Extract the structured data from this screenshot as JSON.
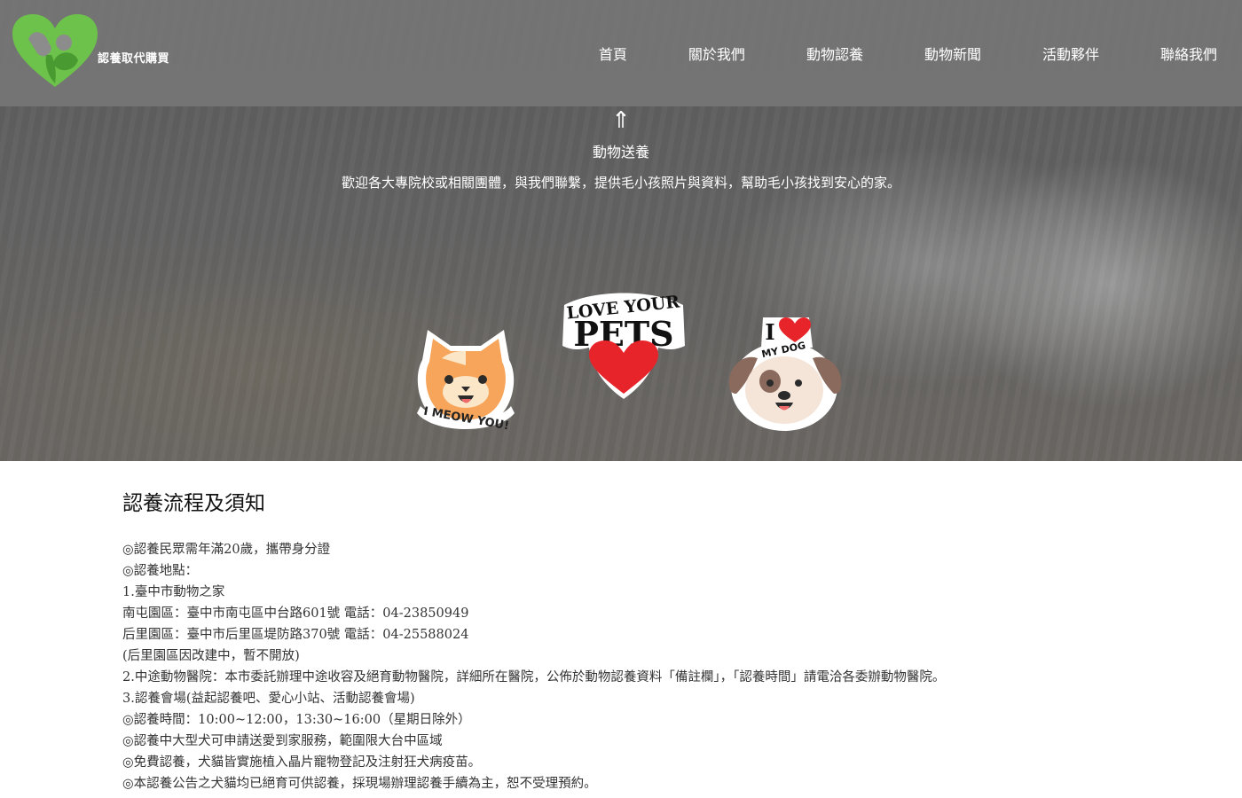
{
  "brand": {
    "logo_text": "認養取代購買",
    "logo_colors": {
      "heart": "#6cc24a",
      "dark": "#4a9a32"
    }
  },
  "nav": {
    "items": [
      {
        "label": "首頁"
      },
      {
        "label": "關於我們"
      },
      {
        "label": "動物認養"
      },
      {
        "label": "動物新聞"
      },
      {
        "label": "活動夥伴"
      },
      {
        "label": "聯絡我們"
      }
    ]
  },
  "hero": {
    "icon": "double-up-arrow-icon",
    "title": "動物送養",
    "description": "歡迎各大專院校或相關團體，與我們聯繫，提供毛小孩照片與資料，幫助毛小孩找到安心的家。",
    "stickers": {
      "cat_text": "I MEOW YOU!",
      "love_line1": "LOVE YOUR",
      "love_line2": "PETS",
      "dog_i": "I",
      "dog_text": "MY DOG"
    }
  },
  "section": {
    "title": "認養流程及須知",
    "lines": [
      "◎認養民眾需年滿20歲，攜帶身分證",
      "◎認養地點：",
      "1.臺中市動物之家",
      "南屯園區：臺中市南屯區中台路601號 電話：04-23850949",
      "后里園區：臺中市后里區堤防路370號 電話：04-25588024",
      "(后里園區因改建中，暫不開放)",
      "2.中途動物醫院：本市委託辦理中途收容及絕育動物醫院，詳細所在醫院，公佈於動物認養資料「備註欄」，「認養時間」請電洽各委辦動物醫院。",
      "3.認養會場(益起認養吧、愛心小站、活動認養會場)",
      "◎認養時間：10:00~12:00，13:30~16:00（星期日除外）",
      "◎認養中大型犬可申請送愛到家服務，範圍限大台中區域",
      "◎免費認養，犬貓皆實施植入晶片寵物登記及注射狂犬病疫苗。",
      "◎本認養公告之犬貓均已絕育可供認養，採現場辦理認養手續為主，恕不受理預約。"
    ]
  }
}
